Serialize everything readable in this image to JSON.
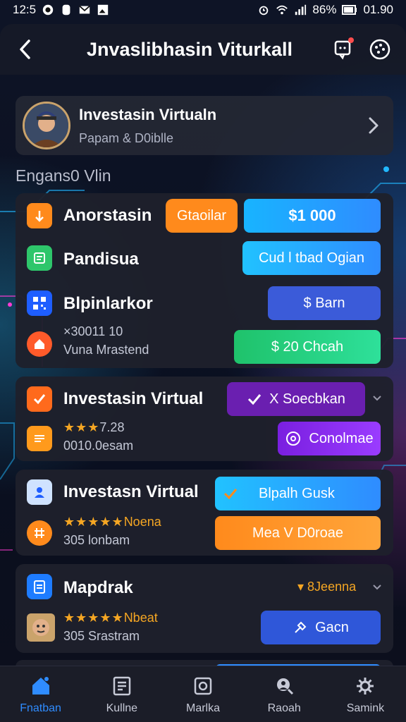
{
  "status_bar": {
    "time": "12:5",
    "battery": "86%",
    "right_time": "01.90"
  },
  "header": {
    "title": "Jnvaslibhasin Viturkall"
  },
  "profile": {
    "name": "Investasin Virtualn",
    "subtitle": "Papam & D0iblle"
  },
  "section_label": "Engans0 Vlin",
  "card1": {
    "row1": {
      "label": "Anorstasin",
      "badge": "Gtaoilar",
      "amount": "$1 000"
    },
    "row2": {
      "label": "Pandisua",
      "button": "Cud l tbad Ogian"
    },
    "row3": {
      "label": "Blpinlarkor",
      "button": "$ Barn"
    },
    "row4": {
      "line1": "×30011 10",
      "line2": "Vuna Mrastend",
      "button": "$ 20 Chcah"
    }
  },
  "card2": {
    "row1": {
      "label": "Investasin Virtual",
      "button": "X Soecbkan"
    },
    "row2": {
      "rating": "7.28",
      "line2": "0010.0esam",
      "button": "Conolmae"
    }
  },
  "card3": {
    "row1": {
      "label": "Investasn Virtual",
      "button": "Blpalh Gusk"
    },
    "row2": {
      "rating_text": "Noena",
      "line2": "305 lonbam",
      "button": "Mea V D0roae"
    }
  },
  "card4": {
    "row1": {
      "label": "Mapdrak",
      "tag": "8Jeenna"
    },
    "row2": {
      "rating_text": "Nbeat",
      "line2": "305 Srastram",
      "button": "Gacn"
    }
  },
  "nav": [
    {
      "label": "Fnatban",
      "icon": "home-icon",
      "active": true
    },
    {
      "label": "Kullne",
      "icon": "document-icon",
      "active": false
    },
    {
      "label": "Marlka",
      "icon": "camera-icon",
      "active": false
    },
    {
      "label": "Raoah",
      "icon": "search-icon",
      "active": false
    },
    {
      "label": "Samink",
      "icon": "gear-icon",
      "active": false
    }
  ],
  "colors": {
    "accent_blue": "#2f8cff",
    "orange": "#ff8a1c",
    "green": "#2ec66b",
    "purple": "#8a2be2",
    "card_bg": "#1e202c"
  }
}
